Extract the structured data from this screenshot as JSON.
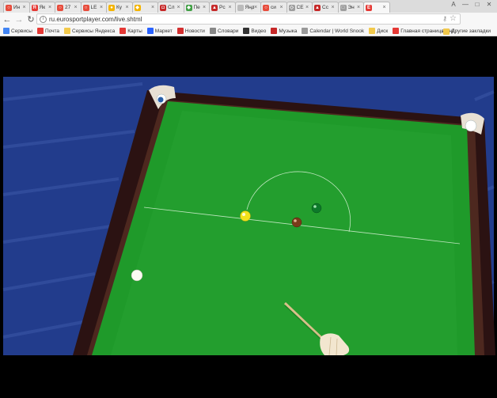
{
  "browser": {
    "tabs": [
      {
        "title": "Ин",
        "favicon_color": "#e74c3c",
        "favicon_glyph": "○"
      },
      {
        "title": "Як",
        "favicon_color": "#e53935",
        "favicon_glyph": "Я"
      },
      {
        "title": "27",
        "favicon_color": "#e74c3c",
        "favicon_glyph": "○"
      },
      {
        "title": "LE",
        "favicon_color": "#e74c3c",
        "favicon_glyph": "○"
      },
      {
        "title": "Ку",
        "favicon_color": "#f4b400",
        "favicon_glyph": "●"
      },
      {
        "title": "",
        "favicon_color": "#f4b400",
        "favicon_glyph": "◆"
      },
      {
        "title": "Сл",
        "favicon_color": "#c62828",
        "favicon_glyph": "◘"
      },
      {
        "title": "Пе",
        "favicon_color": "#43a047",
        "favicon_glyph": "◆"
      },
      {
        "title": "Pc",
        "favicon_color": "#c62828",
        "favicon_glyph": "▲"
      },
      {
        "title": "Яндек",
        "favicon_color": "#bbbbbb",
        "favicon_glyph": ""
      },
      {
        "title": "си",
        "favicon_color": "#e74c3c",
        "favicon_glyph": "○"
      },
      {
        "title": "СЕ",
        "favicon_color": "#9e9e9e",
        "favicon_glyph": "◇"
      },
      {
        "title": "Сс",
        "favicon_color": "#c62828",
        "favicon_glyph": "▲"
      },
      {
        "title": "Эн",
        "favicon_color": "#9e9e9e",
        "favicon_glyph": "□"
      },
      {
        "title": "",
        "favicon_color": "#e53935",
        "favicon_glyph": "E",
        "active": true
      }
    ],
    "url": "ru.eurosportplayer.com/live.shtml",
    "window_buttons": [
      "A",
      "—",
      "□",
      "✕"
    ],
    "bookmarks": [
      {
        "label": "Сервисы",
        "color": "#4285f4"
      },
      {
        "label": "Почта",
        "color": "#e53935"
      },
      {
        "label": "Сервисы Яндекса",
        "color": "#f2c94c"
      },
      {
        "label": "Карты",
        "color": "#e53935"
      },
      {
        "label": "Маркет",
        "color": "#2962ff"
      },
      {
        "label": "Новости",
        "color": "#d32f2f"
      },
      {
        "label": "Словари",
        "color": "#888888"
      },
      {
        "label": "Видео",
        "color": "#333333"
      },
      {
        "label": "Музыка",
        "color": "#c62828"
      },
      {
        "label": "Calendar | World Snook",
        "color": "#999999"
      },
      {
        "label": "Диск",
        "color": "#f2c94c"
      },
      {
        "label": "Главная страница Янд",
        "color": "#e53935"
      }
    ],
    "bookmarks_more": "»",
    "other_bookmarks": "Другие закладки"
  },
  "colors": {
    "felt": "#1f9a2a",
    "cushion": "#2b1212",
    "cloth_blue": "#223c8c"
  }
}
